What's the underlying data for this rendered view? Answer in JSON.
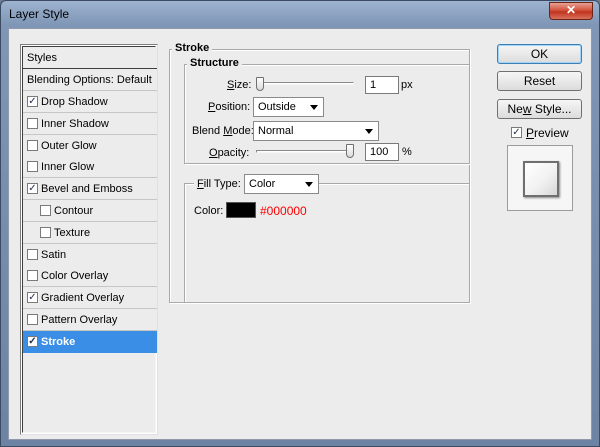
{
  "window": {
    "title": "Layer Style",
    "close_glyph": "✕"
  },
  "styles_list": {
    "header": "Styles",
    "blending_options": "Blending Options: Default",
    "items": [
      {
        "label": "Drop Shadow",
        "checked": true,
        "indent": false,
        "selected": false
      },
      {
        "label": "Inner Shadow",
        "checked": false,
        "indent": false,
        "selected": false
      },
      {
        "label": "Outer Glow",
        "checked": false,
        "indent": false,
        "selected": false
      },
      {
        "label": "Inner Glow",
        "checked": false,
        "indent": false,
        "selected": false
      },
      {
        "label": "Bevel and Emboss",
        "checked": true,
        "indent": false,
        "selected": false
      },
      {
        "label": "Contour",
        "checked": false,
        "indent": true,
        "selected": false
      },
      {
        "label": "Texture",
        "checked": false,
        "indent": true,
        "selected": false
      },
      {
        "label": "Satin",
        "checked": false,
        "indent": false,
        "selected": false
      },
      {
        "label": "Color Overlay",
        "checked": false,
        "indent": false,
        "selected": false
      },
      {
        "label": "Gradient Overlay",
        "checked": true,
        "indent": false,
        "selected": false
      },
      {
        "label": "Pattern Overlay",
        "checked": false,
        "indent": false,
        "selected": false
      },
      {
        "label": "Stroke",
        "checked": true,
        "indent": false,
        "selected": true
      }
    ],
    "selected_color": "#3a8ee6"
  },
  "stroke": {
    "section_title": "Stroke",
    "structure_title": "Structure",
    "size": {
      "label_key": "S",
      "label_rest": "ize:",
      "value": "1",
      "unit": "px",
      "slider_fraction": 0.0
    },
    "position": {
      "label_key": "P",
      "label_rest": "osition:",
      "value": "Outside"
    },
    "blend_mode": {
      "label_pre": "Blend ",
      "label_key": "M",
      "label_rest": "ode:",
      "value": "Normal"
    },
    "opacity": {
      "label_key": "O",
      "label_rest": "pacity:",
      "value": "100",
      "unit": "%",
      "slider_fraction": 1.0
    },
    "fill_type": {
      "label_key": "F",
      "label_rest": "ill Type:",
      "value": "Color"
    },
    "color": {
      "label": "Color:",
      "hex": "#000000",
      "swatch": "#000000"
    }
  },
  "buttons": {
    "ok": "OK",
    "reset": "Reset",
    "new_style_key": "w",
    "new_style_pre": "Ne",
    "new_style_rest": " Style...",
    "preview_key": "P",
    "preview_rest": "review",
    "preview_checked": true
  }
}
